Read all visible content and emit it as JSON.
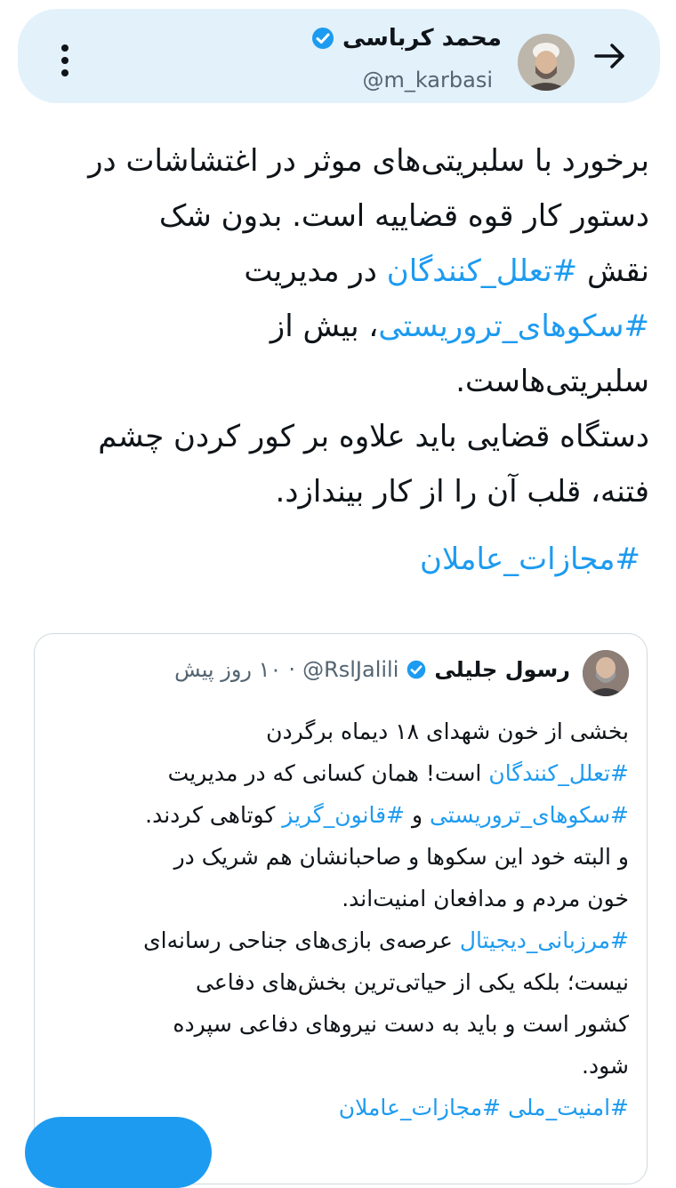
{
  "header": {
    "name": "محمد کرباسی",
    "handle": "@m_karbasi"
  },
  "tweet": {
    "lines": [
      {
        "pre": "برخورد با سلبریتی‌های موثر در اغتشاشات در",
        "tag": "",
        "post": ""
      },
      {
        "pre": "دستور کار قوه قضاییه است. بدون شک",
        "tag": "",
        "post": ""
      },
      {
        "pre": "نقش ",
        "tag": "#تعلل_کنندگان",
        "post": " در مدیریت"
      },
      {
        "pre": "",
        "tag": "#سکوهای_تروریستی",
        "post": "، بیش از"
      },
      {
        "pre": "سلبریتی‌هاست.",
        "tag": "",
        "post": ""
      },
      {
        "pre": "دستگاه قضایی باید علاوه بر کور کردن چشم",
        "tag": "",
        "post": ""
      },
      {
        "pre": "فتنه، قلب آن را از کار بیندازد.",
        "tag": "",
        "post": ""
      }
    ],
    "hashtag": "#مجازات_عاملان"
  },
  "quote": {
    "name": "رسول جلیلی",
    "handle": "@RslJalili",
    "separator": "·",
    "time": "۱۰ روز پیش",
    "lines": [
      {
        "a": "بخشی از خون شهدای ۱۸ دیماه برگردن",
        "b": "",
        "c": "",
        "d": ""
      },
      {
        "a": "",
        "b": "#تعلل_کنندگان",
        "c": " است! همان کسانی که در مدیریت",
        "d": ""
      },
      {
        "a": "",
        "b": "#سکوهای_تروریستی",
        "c": " و ",
        "d": "#قانون_گریز",
        "e": " کوتاهی کردند."
      },
      {
        "a": "و البته خود این سکوها و صاحبانشان هم شریک در",
        "b": "",
        "c": "",
        "d": ""
      },
      {
        "a": "خون مردم و مدافعان امنیت‌اند.",
        "b": "",
        "c": "",
        "d": ""
      },
      {
        "a": "",
        "b": "#مرزبانی_دیجیتال",
        "c": " عرصه‌ی بازی‌های جناحی رسانه‌ای",
        "d": ""
      },
      {
        "a": "نیست؛ بلکه یکی از حیاتی‌ترین بخش‌های دفاعی",
        "b": "",
        "c": "",
        "d": ""
      },
      {
        "a": "کشور است و باید به دست نیروهای دفاعی سپرده",
        "b": "",
        "c": "",
        "d": ""
      },
      {
        "a": "شود.",
        "b": "",
        "c": "",
        "d": ""
      },
      {
        "a": "",
        "b": "#امنیت_ملی",
        "c": " ",
        "d": "#مجازات_عاملان"
      }
    ]
  },
  "colors": {
    "accent": "#1d9bf0",
    "header_bg": "#e3f1fb",
    "muted": "#536471"
  },
  "icons": {
    "back": "arrow-right-icon",
    "more": "more-vertical-icon",
    "verified": "verified-badge-icon"
  }
}
